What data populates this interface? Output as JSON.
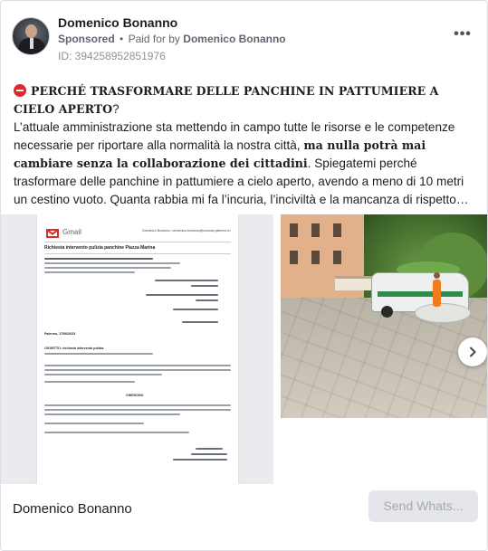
{
  "advertiser": {
    "name": "Domenico Bonanno",
    "sponsored_label": "Sponsored",
    "separator": "•",
    "paid_for_prefix": "Paid for by",
    "payer": "Domenico Bonanno",
    "ad_id": "ID: 394258952851976"
  },
  "menu_icon": "more-dots-icon",
  "post": {
    "headline": "PERCHÉ TRASFORMARE DELLE PANCHINE IN PATTUMIERE A CIELO APERTO",
    "headline_end": "?",
    "text_part1": "L’attuale amministrazione sta mettendo in campo tutte le risorse e le competenze necessarie per riportare alla normalità la nostra città, ",
    "text_bold": "ma nulla potrà mai cambiare senza la collaborazione dei cittadini",
    "text_part2": ". Spiegatemi perché trasformare delle panchine in pattumiere a cielo aperto, avendo a meno di 10 metri un cestino vuoto. Quanta rabbia mi fa l’incuria, l’inciviltà e la mancanza di rispetto…"
  },
  "carousel": {
    "document": {
      "app": "Gmail",
      "sender_line": "Domenico Bonanno <domenico.bonanno@comune.palermo.it>",
      "subject": "Richiesta intervento pulizia panchine Piazza Marina",
      "oggetto": "OGGETTO: richiesta intervento pulizia",
      "chiedono": "CHIEDONO",
      "place_date": "Palermo, 17/06/2023"
    },
    "next_icon": "chevron-right-icon"
  },
  "footer": {
    "name": "Domenico Bonanno",
    "cta_label": "Send Whats..."
  }
}
